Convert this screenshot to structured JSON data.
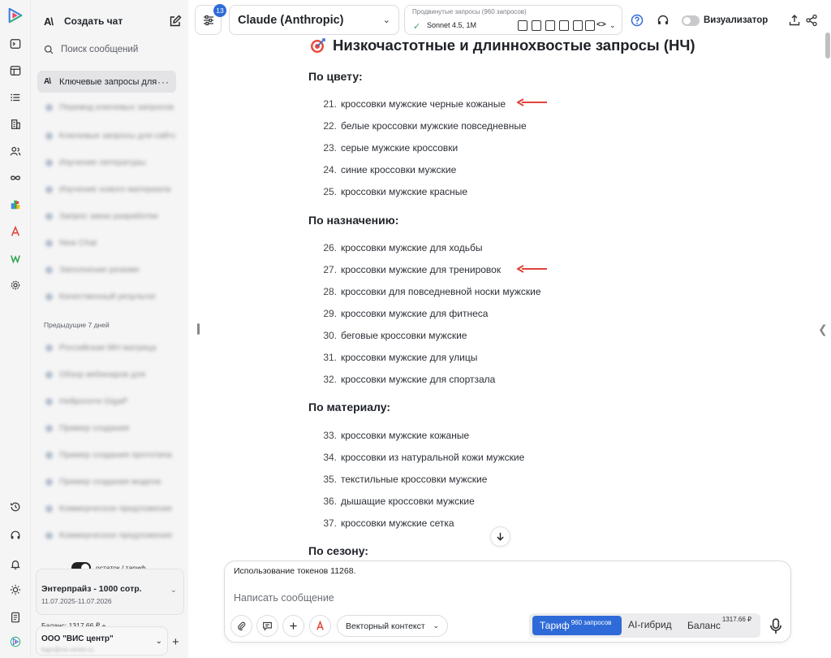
{
  "sidebar": {
    "new_chat_label": "Создать чат",
    "search_placeholder": "Поиск сообщений",
    "active_chat": "Ключевые запросы для",
    "section_previous": "Предыдущие 7 дней",
    "toggle_label": "остаток / тариф",
    "tariff_name": "Энтерпрайз - 1000 сотр.",
    "tariff_dates": "11.07.2025-11.07.2026",
    "balance": "Баланс: 1317.66 ₽ +",
    "org_name": "ООО \"ВИС центр\"",
    "org_email": "login@vis-center.ru",
    "blurred_items": [
      "Перевод ключевых запросов",
      "Ключевые запросы для сайта",
      "Изучение литературы",
      "Изучение нового материала",
      "Запрос заказ разработки",
      "New Chat",
      "Заполнение резюме",
      "Качественный результат",
      "Российская МН матрица",
      "Обзор вебинаров для",
      "Нейросети GigaP",
      "Пример создания",
      "Пример создания прототипа",
      "Пример создания модели",
      "Коммерческое предложение",
      "Коммерческое предложение"
    ]
  },
  "topbar": {
    "badge_count": "13",
    "model_name": "Claude (Anthropic)",
    "advanced_label": "Продвинутые запросы (960 запросов)",
    "advanced_value": "Sonnet 4.5, 1M",
    "code_icon": "<>",
    "visualizer_label": "Визуализатор"
  },
  "content": {
    "title": "Низкочастотные и длиннохвостые запросы (НЧ)",
    "sections": [
      {
        "heading": "По цвету:",
        "items": [
          {
            "num": "21.",
            "text": "кроссовки мужские черные кожаные"
          },
          {
            "num": "22.",
            "text": "белые кроссовки мужские повседневные"
          },
          {
            "num": "23.",
            "text": "серые мужские кроссовки"
          },
          {
            "num": "24.",
            "text": "синие кроссовки мужские"
          },
          {
            "num": "25.",
            "text": "кроссовки мужские красные"
          }
        ]
      },
      {
        "heading": "По назначению:",
        "items": [
          {
            "num": "26.",
            "text": "кроссовки мужские для ходьбы"
          },
          {
            "num": "27.",
            "text": "кроссовки мужские для тренировок"
          },
          {
            "num": "28.",
            "text": "кроссовки для повседневной носки мужские"
          },
          {
            "num": "29.",
            "text": "кроссовки мужские для фитнеса"
          },
          {
            "num": "30.",
            "text": "беговые кроссовки мужские"
          },
          {
            "num": "31.",
            "text": "кроссовки мужские для улицы"
          },
          {
            "num": "32.",
            "text": "кроссовки мужские для спортзала"
          }
        ]
      },
      {
        "heading": "По материалу:",
        "items": [
          {
            "num": "33.",
            "text": "кроссовки мужские кожаные"
          },
          {
            "num": "34.",
            "text": "кроссовки из натуральной кожи мужские"
          },
          {
            "num": "35.",
            "text": "текстильные кроссовки мужские"
          },
          {
            "num": "36.",
            "text": "дышащие кроссовки мужские"
          },
          {
            "num": "37.",
            "text": "кроссовки мужские сетка"
          }
        ]
      },
      {
        "heading": "По сезону:",
        "items": []
      }
    ]
  },
  "composer": {
    "tokens_text": "Использование токенов 11268.",
    "placeholder": "Написать сообщение",
    "vector_label": "Векторный контекст",
    "seg_tariff": "Тариф",
    "seg_tariff_sup": "960 запросов",
    "seg_hybrid": "AI-гибрид",
    "seg_balance": "Баланс",
    "seg_balance_sup": "1317.66 ₽"
  },
  "colors": {
    "accent": "#2f6bd8",
    "arrow": "#e0443a",
    "check": "#3aa55d"
  }
}
